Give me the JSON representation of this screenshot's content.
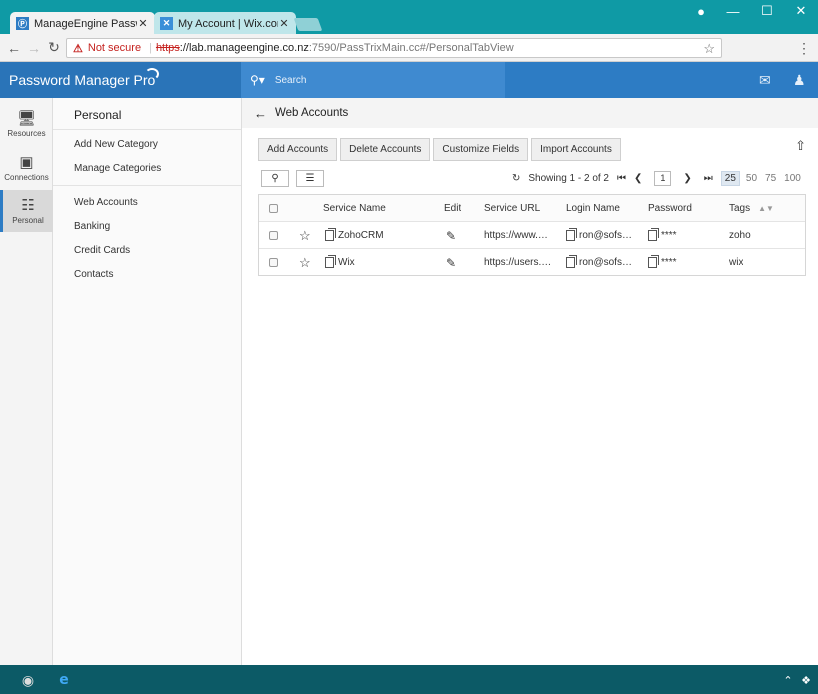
{
  "browser": {
    "tabs": [
      {
        "title": "ManageEngine Password",
        "favicon": "manageengine-icon",
        "active": true
      },
      {
        "title": "My Account | Wix.com",
        "favicon": "wix-icon",
        "active": false
      }
    ],
    "address": {
      "warning_icon": "warning-icon",
      "not_secure": "Not secure",
      "scheme": "https",
      "host": "://lab.manageengine.co.nz",
      "rest": ":7590/PassTrixMain.cc#/PersonalTabView"
    }
  },
  "app": {
    "brand": "Password Manager Pro",
    "search_placeholder": "Search"
  },
  "leftnav": [
    {
      "label": "Resources",
      "icon": "monitor-icon"
    },
    {
      "label": "Connections",
      "icon": "connections-icon"
    },
    {
      "label": "Personal",
      "icon": "personal-icon",
      "active": true
    }
  ],
  "subnav": {
    "title": "Personal",
    "actions": [
      "Add New Category",
      "Manage Categories"
    ],
    "categories": [
      "Web Accounts",
      "Banking",
      "Credit Cards",
      "Contacts"
    ]
  },
  "content": {
    "title": "Web Accounts",
    "buttons": [
      "Add Accounts",
      "Delete Accounts",
      "Customize Fields",
      "Import Accounts"
    ],
    "pager": {
      "showing": "Showing 1 - 2 of 2",
      "page": "1",
      "sizes": [
        "25",
        "50",
        "75",
        "100"
      ],
      "selected_size": "25"
    },
    "table": {
      "headers": [
        "Service Name",
        "Edit",
        "Service URL",
        "Login Name",
        "Password",
        "Tags"
      ],
      "rows": [
        {
          "service": "ZohoCRM",
          "url": "https://www.…",
          "login": "ron@sofs…",
          "password": "****",
          "tags": "zoho"
        },
        {
          "service": "Wix",
          "url": "https://users.…",
          "login": "ron@sofs…",
          "password": "****",
          "tags": "wix"
        }
      ]
    }
  },
  "colors": {
    "accent": "#2d7cc4",
    "chrome_frame": "#0f9aa5",
    "taskbar": "#0c5a66"
  }
}
